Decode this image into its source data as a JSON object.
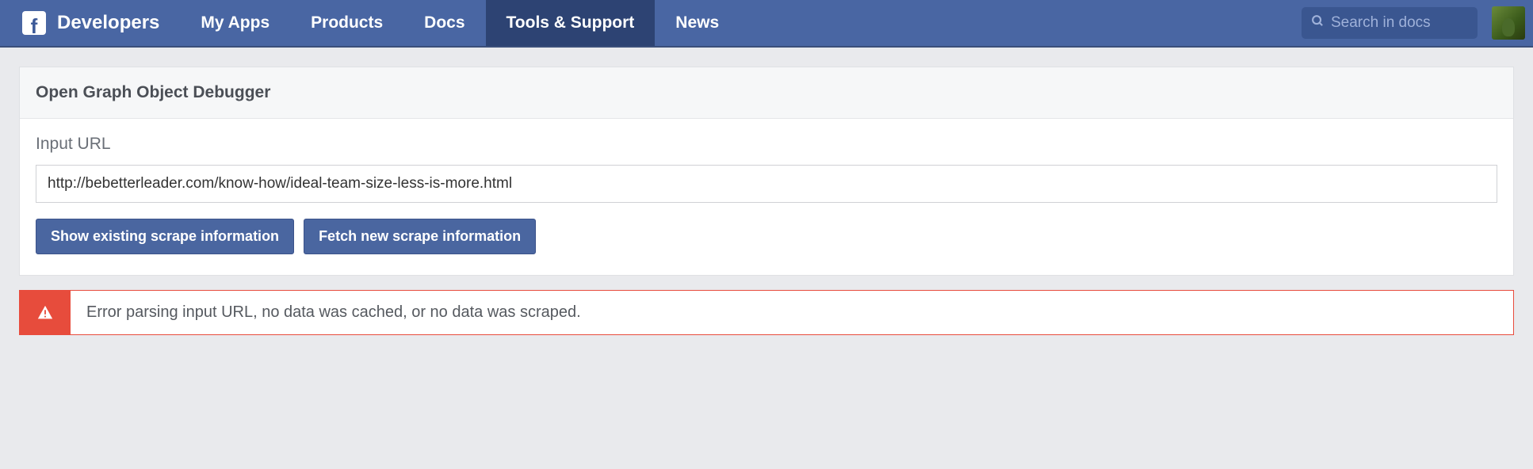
{
  "header": {
    "brand_label": "Developers",
    "nav": [
      {
        "label": "My Apps",
        "active": false
      },
      {
        "label": "Products",
        "active": false
      },
      {
        "label": "Docs",
        "active": false
      },
      {
        "label": "Tools & Support",
        "active": true
      },
      {
        "label": "News",
        "active": false
      }
    ],
    "search_placeholder": "Search in docs"
  },
  "panel": {
    "title": "Open Graph Object Debugger",
    "input_label": "Input URL",
    "input_value": "http://bebetterleader.com/know-how/ideal-team-size-less-is-more.html",
    "buttons": {
      "show_existing": "Show existing scrape information",
      "fetch_new": "Fetch new scrape information"
    }
  },
  "alert": {
    "message": "Error parsing input URL, no data was cached, or no data was scraped."
  }
}
